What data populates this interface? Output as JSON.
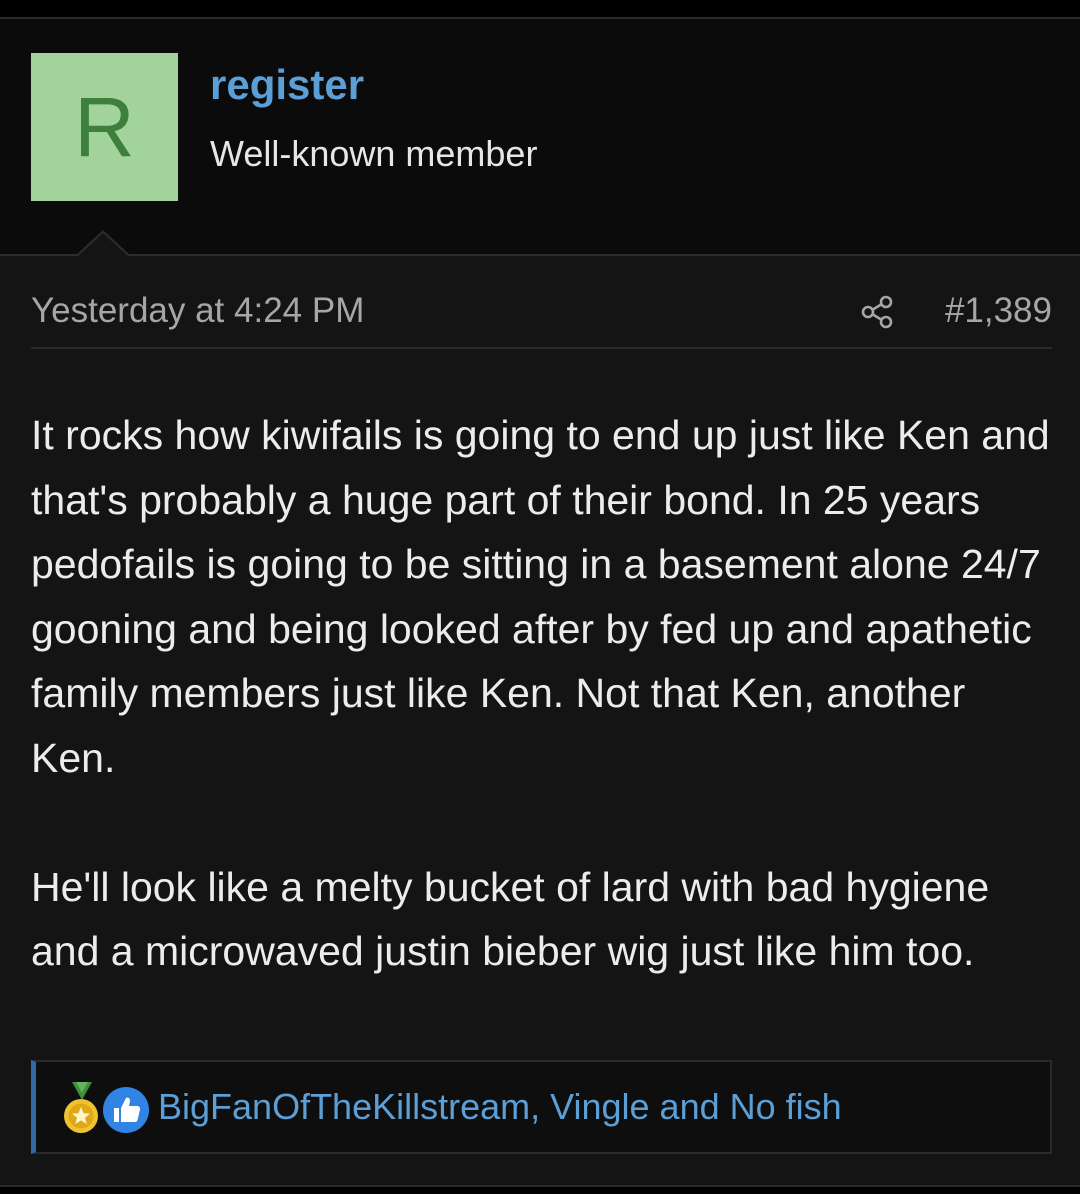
{
  "user": {
    "avatar_letter": "R",
    "username": "register",
    "title": "Well-known member",
    "avatar_bg": "#a3d39c",
    "avatar_fg": "#3e7f3c"
  },
  "post": {
    "timestamp": "Yesterday at 4:24 PM",
    "share_icon": "share-icon",
    "number": "#1,389",
    "paragraphs": [
      "It rocks how kiwifails is going to end up just like Ken and that's probably a huge part of their bond. In 25 years pedofails is going to be sitting in a basement alone 24/7 gooning and being looked after by fed up and apathetic family members just like Ken. Not that Ken, another Ken.",
      "He'll look like a melty bucket of lard with bad hygiene and a microwaved justin bieber wig just like him too."
    ]
  },
  "reactions": {
    "icons": [
      "medal-icon",
      "like-icon"
    ],
    "names": "BigFanOfTheKillstream, Vingle and No fish",
    "link_color": "#5b9fd6"
  }
}
